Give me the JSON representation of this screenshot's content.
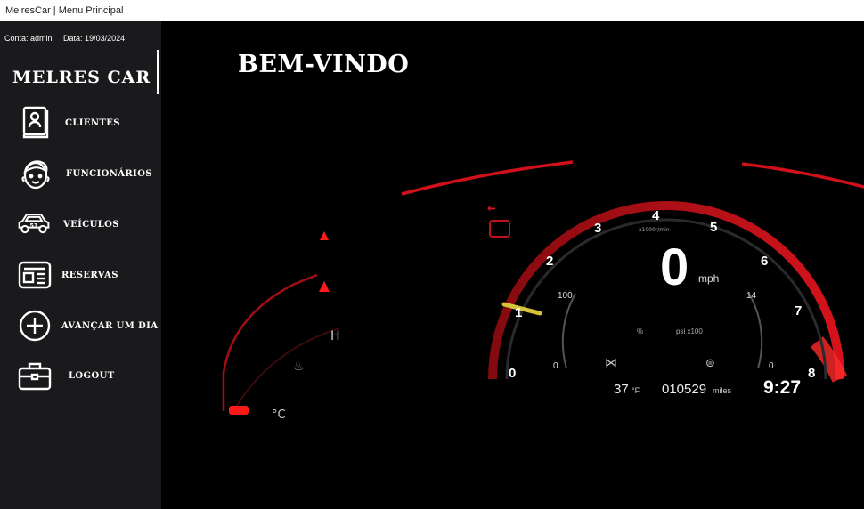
{
  "window": {
    "title": "MelresCar | Menu Principal"
  },
  "sidebar": {
    "account": "Conta: admin",
    "date": "Data: 19/03/2024",
    "brand": "MELRES CAR",
    "items": [
      {
        "label": "CLIENTES",
        "icon": "client-card-icon"
      },
      {
        "label": "FUNCIONÁRIOS",
        "icon": "employee-face-icon"
      },
      {
        "label": "VEÍCULOS",
        "icon": "car-icon"
      },
      {
        "label": "RESERVAS",
        "icon": "reservation-icon"
      },
      {
        "label": "AVANÇAR UM DIA",
        "icon": "plus-circle-icon"
      },
      {
        "label": "LOGOUT",
        "icon": "briefcase-icon"
      }
    ]
  },
  "main": {
    "heading": "BEM-VINDO",
    "dashboard": {
      "tach_numbers": [
        "0",
        "1",
        "2",
        "3",
        "4",
        "5",
        "6",
        "7",
        "8"
      ],
      "tach_unit": "x1000r/min",
      "speed": "0",
      "speed_unit": "mph",
      "left_gauge_max": "100",
      "left_gauge_min": "0",
      "left_gauge_unit": "%",
      "right_gauge_max": "14",
      "right_gauge_min": "0",
      "right_gauge_unit": "psi x100",
      "temperature": "37",
      "temperature_unit": "°F",
      "odometer": "010529",
      "odometer_unit": "miles",
      "clock": "9:27",
      "hot_label": "H",
      "cold_label": "°C"
    },
    "colors": {
      "accent_red": "#e0141e",
      "gauge_bg": "#0b0b0d"
    }
  }
}
